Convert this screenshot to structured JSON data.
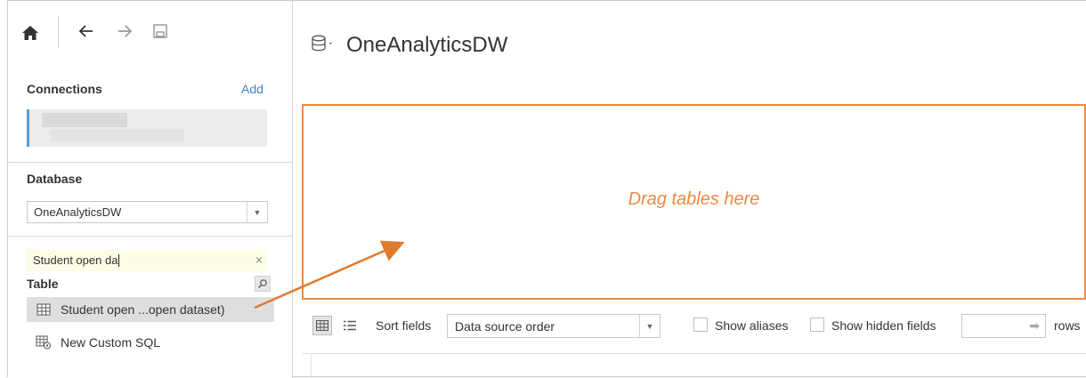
{
  "toolbar": {
    "home": "home-icon",
    "back": "back-arrow-icon",
    "forward": "forward-arrow-icon",
    "save": "save-icon"
  },
  "connections": {
    "title": "Connections",
    "add_label": "Add"
  },
  "database": {
    "title": "Database",
    "selected": "OneAnalyticsDW"
  },
  "table_search": {
    "value": "Student open da",
    "clear": "×"
  },
  "table_section": {
    "title": "Table",
    "items": [
      {
        "label": "Student open ...open dataset)",
        "icon": "table-grid-icon"
      }
    ],
    "custom_sql_label": "New Custom SQL"
  },
  "canvas": {
    "datasource_title": "OneAnalyticsDW",
    "drop_hint": "Drag tables here"
  },
  "grid_toolbar": {
    "sort_label": "Sort fields",
    "sort_value": "Data source order",
    "show_aliases": "Show aliases",
    "show_hidden": "Show hidden fields",
    "rows_label": "rows",
    "rows_value": ""
  },
  "colors": {
    "accent_orange": "#f0883e",
    "link_blue": "#3a86c8",
    "connection_bar": "#5a9bd4"
  }
}
